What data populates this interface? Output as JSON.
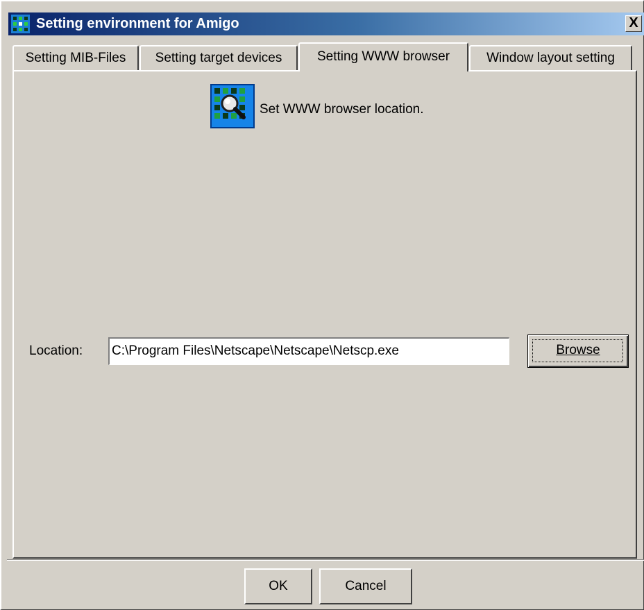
{
  "window": {
    "title": "Setting environment for Amigo",
    "close_symbol": "X"
  },
  "tabs": [
    {
      "label": "Setting MIB-Files",
      "active": false
    },
    {
      "label": "Setting target devices",
      "active": false
    },
    {
      "label": "Setting WWW browser",
      "active": true
    },
    {
      "label": "Window layout setting",
      "active": false
    }
  ],
  "panel": {
    "icon": "browser-settings-icon",
    "heading": "Set WWW browser location.",
    "location_label": "Location:",
    "location_value": "C:\\Program Files\\Netscape\\Netscape\\Netscp.exe",
    "browse_label": "Browse"
  },
  "footer": {
    "ok_label": "OK",
    "cancel_label": "Cancel"
  },
  "colors": {
    "window_bg": "#d4d0c8",
    "titlebar_start": "#0a246a",
    "titlebar_end": "#a6caf0",
    "icon_blue": "#1684e8"
  }
}
